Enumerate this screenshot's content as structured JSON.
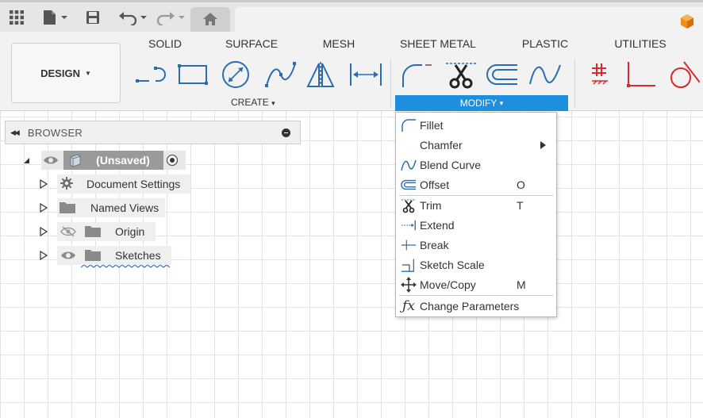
{
  "topbar": {
    "icons": [
      "grid-apps-icon",
      "file-icon",
      "save-icon",
      "undo-icon",
      "redo-icon",
      "home-icon"
    ]
  },
  "workspace": {
    "design_label": "DESIGN"
  },
  "tabs": [
    {
      "label": "SOLID"
    },
    {
      "label": "SURFACE"
    },
    {
      "label": "MESH"
    },
    {
      "label": "SHEET METAL"
    },
    {
      "label": "PLASTIC"
    },
    {
      "label": "UTILITIES"
    }
  ],
  "groups": {
    "create_label": "CREATE",
    "modify_label": "MODIFY",
    "caret": "▾"
  },
  "browser": {
    "title": "BROWSER",
    "root_label": "(Unsaved)",
    "items": [
      {
        "label": "Document Settings",
        "icon": "gear-icon"
      },
      {
        "label": "Named Views",
        "icon": "folder-icon"
      },
      {
        "label": "Origin",
        "icon": "folder-icon"
      },
      {
        "label": "Sketches",
        "icon": "folder-icon"
      }
    ]
  },
  "modify_menu": {
    "items": [
      {
        "label": "Fillet",
        "shortcut": "",
        "icon": "fillet-icon"
      },
      {
        "label": "Chamfer",
        "shortcut": "",
        "icon": "",
        "submenu": true
      },
      {
        "label": "Blend Curve",
        "shortcut": "",
        "icon": "blend-curve-icon"
      },
      {
        "label": "Offset",
        "shortcut": "O",
        "icon": "offset-icon"
      },
      {
        "label": "Trim",
        "shortcut": "T",
        "icon": "trim-icon"
      },
      {
        "label": "Extend",
        "shortcut": "",
        "icon": "extend-icon"
      },
      {
        "label": "Break",
        "shortcut": "",
        "icon": "break-icon"
      },
      {
        "label": "Sketch Scale",
        "shortcut": "",
        "icon": "sketch-scale-icon"
      },
      {
        "label": "Move/Copy",
        "shortcut": "M",
        "icon": "move-icon"
      },
      {
        "label": "Change Parameters",
        "shortcut": "",
        "icon": "fx-icon"
      }
    ]
  },
  "colors": {
    "accent": "#1e8fde",
    "sketch_red": "#d42b2b",
    "sketch_blue": "#2a6db5"
  }
}
